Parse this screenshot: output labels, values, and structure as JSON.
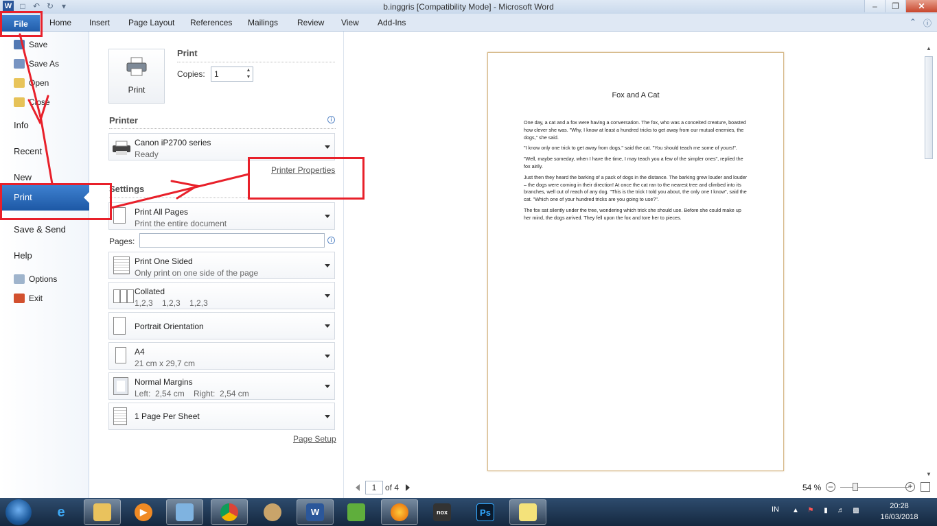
{
  "window": {
    "title": "b.inggris [Compatibility Mode] - Microsoft Word"
  },
  "ribbon": {
    "file_tab": "File",
    "tabs": [
      "Home",
      "Insert",
      "Page Layout",
      "References",
      "Mailings",
      "Review",
      "View",
      "Add-Ins"
    ]
  },
  "nav": {
    "save": "Save",
    "save_as": "Save As",
    "open": "Open",
    "close": "Close",
    "info": "Info",
    "recent": "Recent",
    "new": "New",
    "print": "Print",
    "save_send": "Save & Send",
    "help": "Help",
    "options": "Options",
    "exit": "Exit"
  },
  "print": {
    "heading": "Print",
    "button_label": "Print",
    "copies_label": "Copies:",
    "copies_value": "1",
    "printer_heading": "Printer",
    "printer_name": "Canon iP2700 series",
    "printer_status": "Ready",
    "printer_properties": "Printer Properties",
    "settings_heading": "Settings",
    "pages_label": "Pages:",
    "pages_value": "",
    "print_range": {
      "title": "Print All Pages",
      "subtitle": "Print the entire document"
    },
    "sides": {
      "title": "Print One Sided",
      "subtitle": "Only print on one side of the page"
    },
    "collation": {
      "title": "Collated",
      "subtitle": "1,2,3    1,2,3    1,2,3"
    },
    "orientation": {
      "title": "Portrait Orientation"
    },
    "paper": {
      "title": "A4",
      "subtitle": "21 cm x 29,7 cm"
    },
    "margins": {
      "title": "Normal Margins",
      "subtitle": "Left:  2,54 cm    Right:  2,54 cm"
    },
    "per_sheet": {
      "title": "1 Page Per Sheet"
    },
    "page_setup": "Page Setup"
  },
  "preview": {
    "doc_title": "Fox and A Cat",
    "paragraphs": [
      "One day, a cat and a fox were having a conversation. The fox, who was a conceited creature, boasted how clever she was. \"Why, I know at least a hundred tricks to get away from our mutual enemies, the dogs,\" she said.",
      "\"I know only one trick to get away from dogs,\" said the cat. \"You should teach me some of yours!\".",
      "\"Well, maybe someday, when I have the time, I may teach you a few of the simpler ones\", replied the fox airily.",
      "Just then they heard the barking of a pack of dogs in the distance. The barking grew louder and louder – the dogs were coming in their direction! At once the cat ran to the nearest tree and climbed into its branches, well out of reach of any dog. \"This is the trick I told you about, the only one I know\", said the cat. \"Which one of your hundred tricks are you going to use?\".",
      "The fox sat silently under the tree, wondering which trick she should use. Before she could make up her mind, the dogs arrived. They fell upon the fox and tore her to pieces."
    ],
    "current_page": "1",
    "page_of": "of 4",
    "zoom": "54 %"
  },
  "taskbar": {
    "language": "IN",
    "time": "20:28",
    "date": "16/03/2018"
  },
  "colors": {
    "accent": "#2b6cc4",
    "annotation": "#e8202a",
    "taskbar": "#1d3552"
  }
}
